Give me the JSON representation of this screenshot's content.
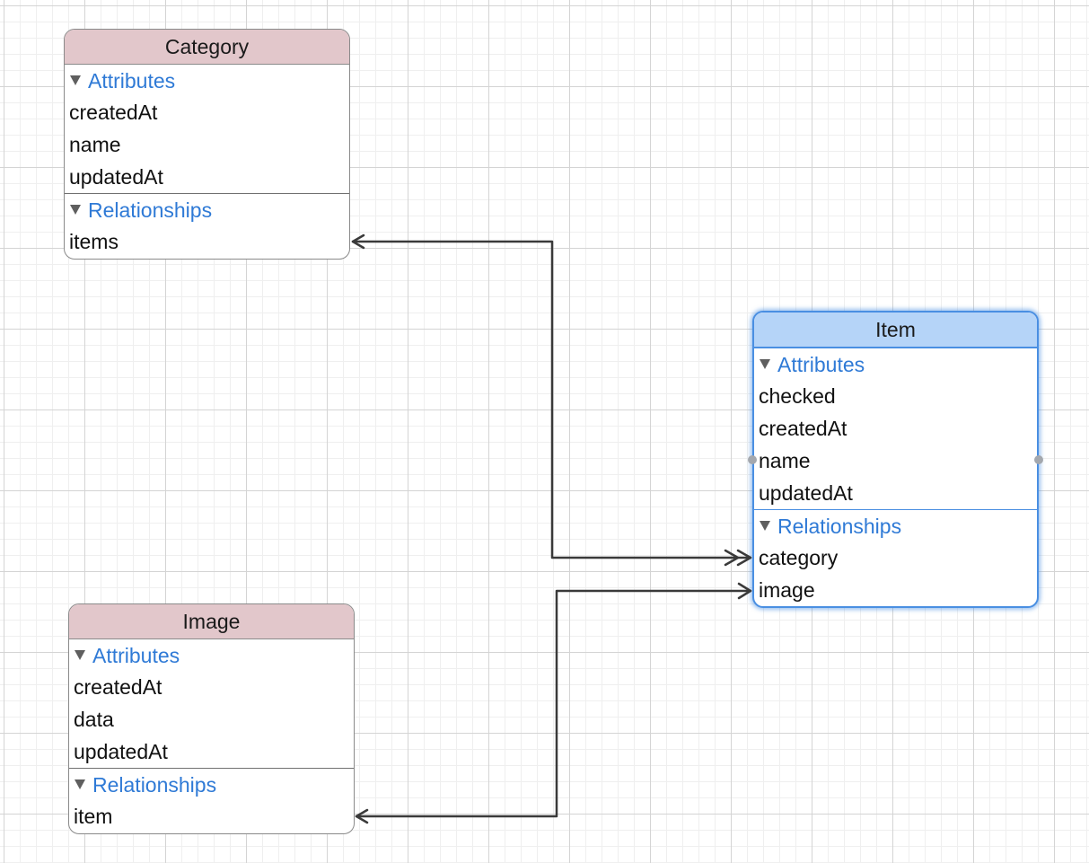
{
  "entities": {
    "category": {
      "name": "Category",
      "attributes_title": "Attributes",
      "attributes": [
        "createdAt",
        "name",
        "updatedAt"
      ],
      "relationships_title": "Relationships",
      "relationships": [
        "items"
      ]
    },
    "item": {
      "name": "Item",
      "attributes_title": "Attributes",
      "attributes": [
        "checked",
        "createdAt",
        "name",
        "updatedAt"
      ],
      "relationships_title": "Relationships",
      "relationships": [
        "category",
        "image"
      ]
    },
    "image": {
      "name": "Image",
      "attributes_title": "Attributes",
      "attributes": [
        "createdAt",
        "data",
        "updatedAt"
      ],
      "relationships_title": "Relationships",
      "relationships": [
        "item"
      ]
    }
  },
  "relationships": [
    {
      "from": "Category.items",
      "to": "Item.category",
      "cardinality": "to-many / to-one"
    },
    {
      "from": "Image.item",
      "to": "Item.image",
      "cardinality": "to-one / to-one"
    }
  ],
  "colors": {
    "entity_header": "#e2c7cb",
    "selected_header": "#b5d4f8",
    "selected_border": "#4a8fe2",
    "section_title": "#2f7ad6",
    "connector": "#3a3a3a"
  }
}
